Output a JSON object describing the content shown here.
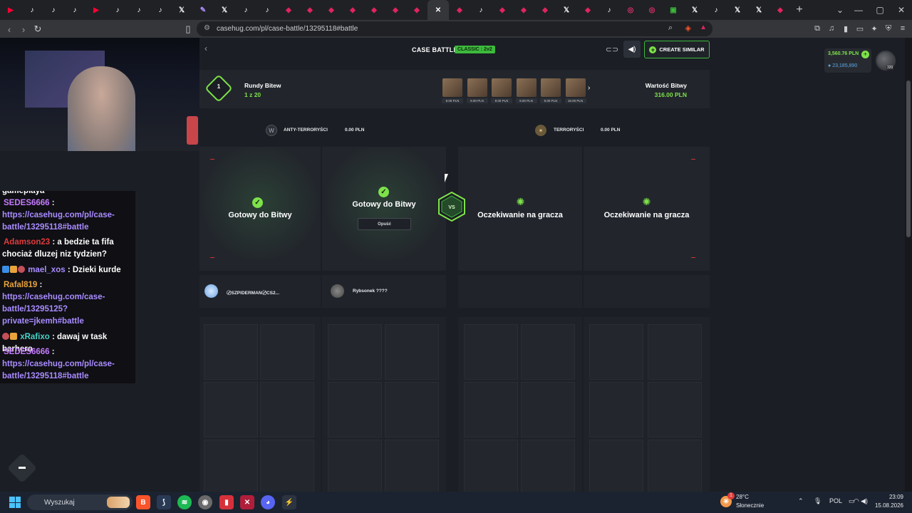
{
  "browser": {
    "url": "casehug.com/pl/case-battle/13295118#battle",
    "tabs": [
      {
        "icon": "youtube-icon",
        "color": "#ff0033",
        "glyph": "▶"
      },
      {
        "icon": "tiktok-icon",
        "color": "#ffffff",
        "glyph": "♪"
      },
      {
        "icon": "tiktok-icon",
        "color": "#ffffff",
        "glyph": "♪"
      },
      {
        "icon": "tiktok-icon",
        "color": "#ffffff",
        "glyph": "♪"
      },
      {
        "icon": "youtube-icon",
        "color": "#ff0033",
        "glyph": "▶"
      },
      {
        "icon": "tiktok-icon",
        "color": "#ffffff",
        "glyph": "♪"
      },
      {
        "icon": "tiktok-icon",
        "color": "#ffffff",
        "glyph": "♪"
      },
      {
        "icon": "tiktok-icon",
        "color": "#ffffff",
        "glyph": "♪"
      },
      {
        "icon": "x-icon",
        "color": "#ffffff",
        "glyph": "𝕏"
      },
      {
        "icon": "feather-icon",
        "color": "#b18cff",
        "glyph": "✎"
      },
      {
        "icon": "x-icon",
        "color": "#ffffff",
        "glyph": "𝕏"
      },
      {
        "icon": "tiktok-icon",
        "color": "#ffffff",
        "glyph": "♪"
      },
      {
        "icon": "tiktok-icon",
        "color": "#ffffff",
        "glyph": "♪"
      },
      {
        "icon": "casehug-icon",
        "color": "#e0245e",
        "glyph": "◆"
      },
      {
        "icon": "casehug-icon",
        "color": "#e0245e",
        "glyph": "◆"
      },
      {
        "icon": "casehug-icon",
        "color": "#e0245e",
        "glyph": "◆"
      },
      {
        "icon": "casehug-icon",
        "color": "#e0245e",
        "glyph": "◆"
      },
      {
        "icon": "casehug-icon",
        "color": "#e0245e",
        "glyph": "◆"
      },
      {
        "icon": "casehug-icon",
        "color": "#e0245e",
        "glyph": "◆"
      },
      {
        "icon": "casehug-icon",
        "color": "#e0245e",
        "glyph": "◆"
      },
      {
        "icon": "close-icon",
        "color": "#ffffff",
        "glyph": "✕",
        "active": true
      },
      {
        "icon": "casehug-icon",
        "color": "#e0245e",
        "glyph": "◆"
      },
      {
        "icon": "tiktok-icon",
        "color": "#ffffff",
        "glyph": "♪"
      },
      {
        "icon": "casehug-icon",
        "color": "#e0245e",
        "glyph": "◆"
      },
      {
        "icon": "casehug-icon",
        "color": "#e0245e",
        "glyph": "◆"
      },
      {
        "icon": "casehug-icon",
        "color": "#e0245e",
        "glyph": "◆"
      },
      {
        "icon": "x-icon",
        "color": "#ffffff",
        "glyph": "𝕏"
      },
      {
        "icon": "casehug-icon",
        "color": "#e0245e",
        "glyph": "◆"
      },
      {
        "icon": "tiktok-icon",
        "color": "#ffffff",
        "glyph": "♪"
      },
      {
        "icon": "instagram-icon",
        "color": "#e1306c",
        "glyph": "◎"
      },
      {
        "icon": "instagram-icon",
        "color": "#e1306c",
        "glyph": "◎"
      },
      {
        "icon": "gallery-icon",
        "color": "#3dba3c",
        "glyph": "▣"
      },
      {
        "icon": "x-icon",
        "color": "#ffffff",
        "glyph": "𝕏"
      },
      {
        "icon": "tiktok-icon",
        "color": "#ffffff",
        "glyph": "♪"
      },
      {
        "icon": "x-icon",
        "color": "#ffffff",
        "glyph": "𝕏"
      },
      {
        "icon": "x-icon",
        "color": "#ffffff",
        "glyph": "𝕏"
      },
      {
        "icon": "casehug-icon",
        "color": "#e0245e",
        "glyph": "◆"
      }
    ]
  },
  "header": {
    "title": "CASE BATTLE",
    "mode": "CLASSIC : 2v2",
    "create_similar": "CREATE SIMILAR"
  },
  "account": {
    "balance_pln": "3,560.76 PLN",
    "coins": "23,185,890",
    "level": "320"
  },
  "rounds": {
    "current": "1",
    "label": "Rundy Bitew",
    "count": "1 z 20",
    "value_label": "Wartość Bitwy",
    "value_amount": "316.00 PLN",
    "cases": [
      {
        "price": "9.00 PLN"
      },
      {
        "price": "9.00 PLN"
      },
      {
        "price": "9.00 PLN"
      },
      {
        "price": "9.00 PLN"
      },
      {
        "price": "9.00 PLN"
      },
      {
        "price": "16.00 PLN"
      }
    ]
  },
  "teams": {
    "ct_name": "ANTY-TERRORYŚCI",
    "ct_value": "0.00 PLN",
    "t_name": "TERRORYŚCI",
    "t_value": "0.00 PLN"
  },
  "slots": [
    {
      "status": "Gotowy do Bitwy",
      "state": "ready"
    },
    {
      "status": "Gotowy do Bitwy",
      "state": "ready",
      "action": "Opuść"
    },
    {
      "status": "Oczekiwanie na gracza",
      "state": "waiting"
    },
    {
      "status": "Oczekiwanie na gracza",
      "state": "waiting"
    }
  ],
  "vs_label": "VS",
  "players": [
    {
      "name": "〄SZPIDERMAN〄CS2..."
    },
    {
      "name": "Rybsonek ????"
    }
  ],
  "chat": {
    "messages": [
      {
        "user": "SEDES6666",
        "user_color": "#c57bff",
        "text": "https://casehug.com/pl/case-battle/13295118#battle",
        "is_link": true
      },
      {
        "user": "Adamson23",
        "user_color": "#e03b3b",
        "text": "a bedzie ta fifa chociaż dluzej niz tydzien?",
        "is_link": false
      },
      {
        "user": "mael_xos",
        "user_color": "#a98cff",
        "text": "Dzieki kurde",
        "is_link": false
      },
      {
        "user": "Rafal819",
        "user_color": "#e8a33b",
        "text": "https://casehug.com/case-battle/13295125?private=jkemh#battle",
        "is_link": true
      },
      {
        "user": "xRafixo",
        "user_color": "#46d3c8",
        "text": "dawaj w task barhero",
        "is_link": false
      },
      {
        "user": "SEDES6666",
        "user_color": "#c57bff",
        "text": "https://casehug.com/pl/case-battle/13295118#battle",
        "is_link": true
      }
    ],
    "partial_top": "gameplaya"
  },
  "taskbar": {
    "search_placeholder": "Wyszukaj",
    "weather_temp": "28°C",
    "weather_desc": "Słonecznie",
    "weather_alert": "1",
    "lang": "POL",
    "time": "23:09",
    "date": "15.08.2026"
  }
}
